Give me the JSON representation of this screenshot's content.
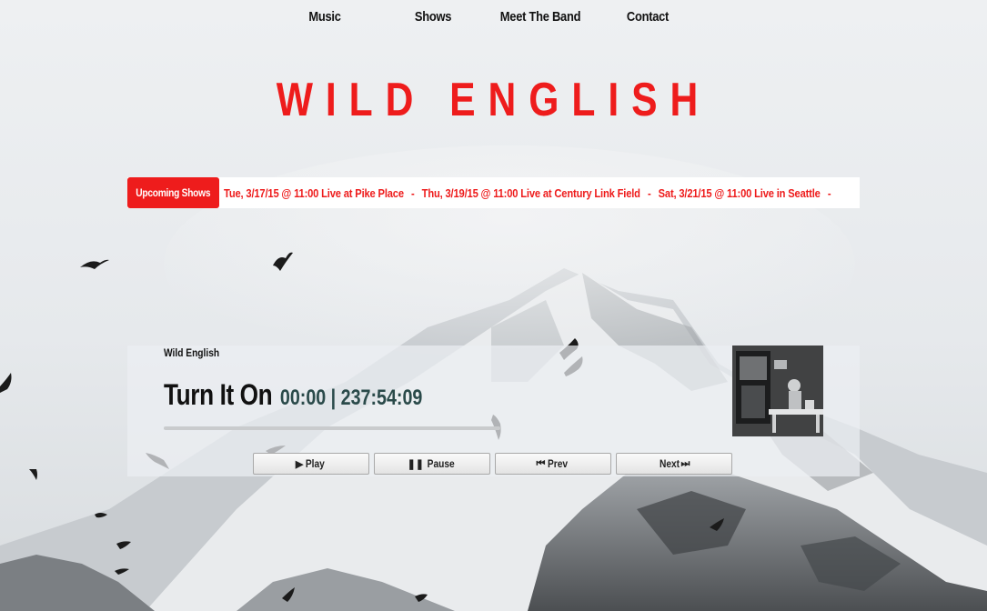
{
  "nav": {
    "items": [
      {
        "label": "Music"
      },
      {
        "label": "Shows"
      },
      {
        "label": "Meet The Band"
      },
      {
        "label": "Contact"
      }
    ]
  },
  "site": {
    "title": "WILD ENGLISH",
    "accent_color": "#ee1c1c"
  },
  "ticker": {
    "badge": "Upcoming Shows",
    "shows": [
      "Tue, 3/17/15 @ 11:00 Live at Pike Place",
      "Thu, 3/19/15 @ 11:00 Live at Century Link Field",
      "Sat, 3/21/15 @ 11:00 Live in Seattle"
    ],
    "separator": "-"
  },
  "player": {
    "artist": "Wild English",
    "track_title": "Turn It On",
    "time_display": "00:00 | 237:54:09",
    "progress": 0,
    "buttons": {
      "play": {
        "label": "Play",
        "icon": "play-icon"
      },
      "pause": {
        "label": "Pause",
        "icon": "pause-icon"
      },
      "prev": {
        "label": "Prev",
        "icon": "previous-icon"
      },
      "next": {
        "label": "Next",
        "icon": "next-icon"
      }
    }
  }
}
